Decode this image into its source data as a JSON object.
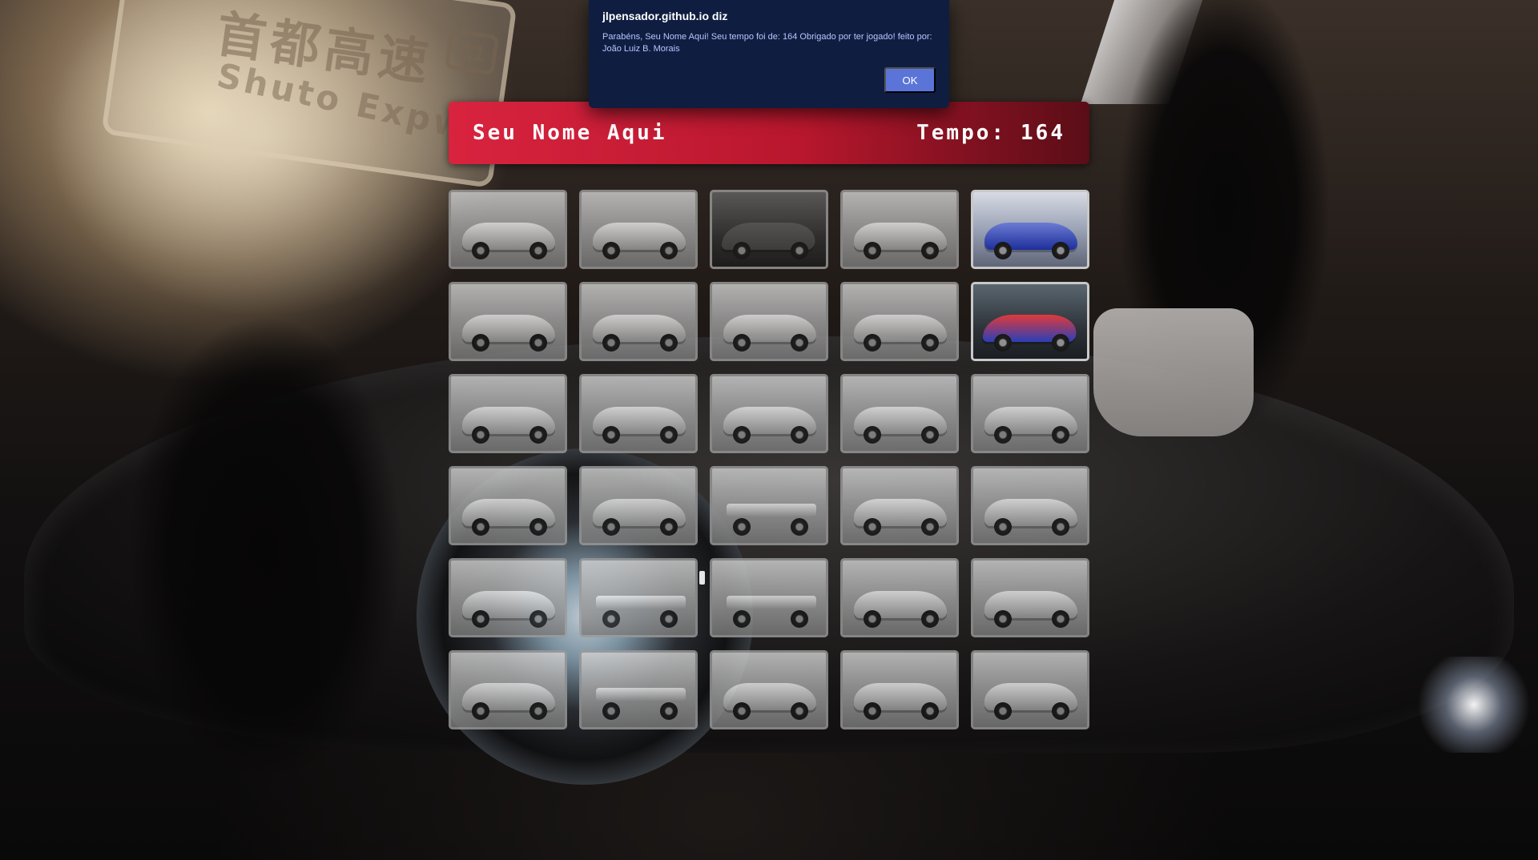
{
  "background": {
    "sign_japanese": "首都高速",
    "sign_english": "Shuto Expwy",
    "sign_badge": "C1"
  },
  "header": {
    "player_name": "Seu Nome Aqui",
    "time_label": "Tempo:",
    "time_value": "164",
    "accent_color": "#d9233f"
  },
  "board": {
    "columns": 5,
    "rows": 6,
    "revealed_count": 2,
    "cards": [
      {
        "icon": "car-icon",
        "revealed": false
      },
      {
        "icon": "car-icon",
        "revealed": false
      },
      {
        "icon": "car-icon",
        "revealed": false
      },
      {
        "icon": "car-icon",
        "revealed": false
      },
      {
        "icon": "car-icon",
        "revealed": true
      },
      {
        "icon": "car-icon",
        "revealed": false
      },
      {
        "icon": "car-icon",
        "revealed": false
      },
      {
        "icon": "car-icon",
        "revealed": false
      },
      {
        "icon": "car-icon",
        "revealed": false
      },
      {
        "icon": "car-icon",
        "revealed": true
      },
      {
        "icon": "car-icon",
        "revealed": false
      },
      {
        "icon": "car-icon",
        "revealed": false
      },
      {
        "icon": "car-icon",
        "revealed": false
      },
      {
        "icon": "car-icon",
        "revealed": false
      },
      {
        "icon": "car-icon",
        "revealed": false
      },
      {
        "icon": "car-icon",
        "revealed": false
      },
      {
        "icon": "car-icon",
        "revealed": false
      },
      {
        "icon": "car-icon",
        "revealed": false
      },
      {
        "icon": "car-icon",
        "revealed": false
      },
      {
        "icon": "car-icon",
        "revealed": false
      },
      {
        "icon": "car-icon",
        "revealed": false
      },
      {
        "icon": "car-icon",
        "revealed": false
      },
      {
        "icon": "car-icon",
        "revealed": false
      },
      {
        "icon": "car-icon",
        "revealed": false
      },
      {
        "icon": "car-icon",
        "revealed": false
      },
      {
        "icon": "car-icon",
        "revealed": false
      },
      {
        "icon": "car-icon",
        "revealed": false
      },
      {
        "icon": "car-icon",
        "revealed": false
      },
      {
        "icon": "car-icon",
        "revealed": false
      },
      {
        "icon": "car-icon",
        "revealed": false
      }
    ]
  },
  "dialog": {
    "title": "jlpensador.github.io diz",
    "message": "Parabéns, Seu Nome Aqui! Seu tempo foi de: 164  Obrigado por ter jogado! feito   por: João Luiz B. Morais",
    "ok_label": "OK",
    "background_color": "#0f1e40",
    "button_color": "#5b74d8"
  }
}
